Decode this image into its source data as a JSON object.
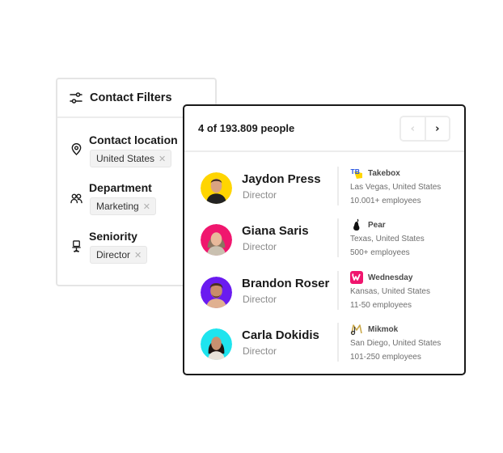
{
  "filters": {
    "title": "Contact Filters",
    "icon": "sliders-icon",
    "groups": [
      {
        "label": "Contact location",
        "icon": "location-pin-icon",
        "chip": "United States",
        "chip_remove": "✕"
      },
      {
        "label": "Department",
        "icon": "people-icon",
        "chip": "Marketing",
        "chip_remove": "✕"
      },
      {
        "label": "Seniority",
        "icon": "office-chair-icon",
        "chip": "Director",
        "chip_remove": "✕"
      }
    ]
  },
  "people": {
    "count_text": "4 of 193.809 people",
    "pager": {
      "prev": "‹",
      "next": "›"
    },
    "rows": [
      {
        "name": "Jaydon Press",
        "title": "Director",
        "avatar_bg": "#FFD500",
        "company": "Takebox",
        "company_logo": "takebox-logo-icon",
        "location": "Las Vegas, United States",
        "employees": "10.001+ employees"
      },
      {
        "name": "Giana Saris",
        "title": "Director",
        "avatar_bg": "#F0166E",
        "company": "Pear",
        "company_logo": "pear-logo-icon",
        "location": "Texas, United States",
        "employees": "500+ employees"
      },
      {
        "name": "Brandon Roser",
        "title": "Director",
        "avatar_bg": "#6A1BF0",
        "company": "Wednesday",
        "company_logo": "wednesday-logo-icon",
        "location": "Kansas, United States",
        "employees": "11-50 employees"
      },
      {
        "name": "Carla Dokidis",
        "title": "Director",
        "avatar_bg": "#1EE4EE",
        "company": "Mikmok",
        "company_logo": "mikmok-logo-icon",
        "location": "San Diego, United States",
        "employees": "101-250 employees"
      }
    ]
  },
  "colors": {
    "takebox_blue": "#1F4FE0",
    "takebox_yellow": "#FFD500",
    "wednesday_pink": "#F0166E",
    "mikmok_gold": "#C9A84A"
  }
}
